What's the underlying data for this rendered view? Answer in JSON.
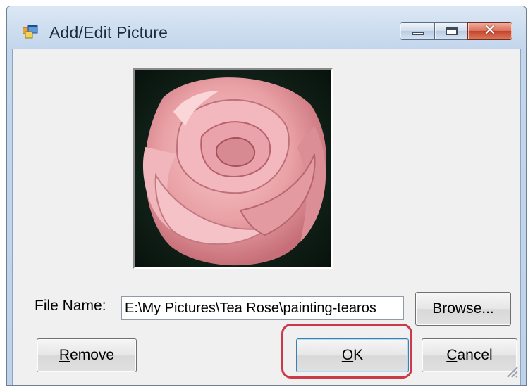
{
  "window": {
    "title": "Add/Edit Picture",
    "app_icon": "windows-form-icon",
    "minimize_icon": "minimize-icon",
    "maximize_icon": "maximize-icon",
    "close_icon": "close-icon",
    "close_glyph": "✕"
  },
  "picture": {
    "subject": "pink tea rose"
  },
  "file": {
    "label": "File Name:",
    "value": "E:\\My Pictures\\Tea Rose\\painting-tearos"
  },
  "buttons": {
    "browse_label": "Browse...",
    "remove_mnemonic": "R",
    "remove_rest": "emove",
    "ok_mnemonic": "O",
    "ok_rest": "K",
    "cancel_mnemonic": "C",
    "cancel_rest": "ancel"
  },
  "colors": {
    "highlight": "#cc3a49",
    "accent": "#3c7fb1",
    "close_button": "#c5432a"
  }
}
